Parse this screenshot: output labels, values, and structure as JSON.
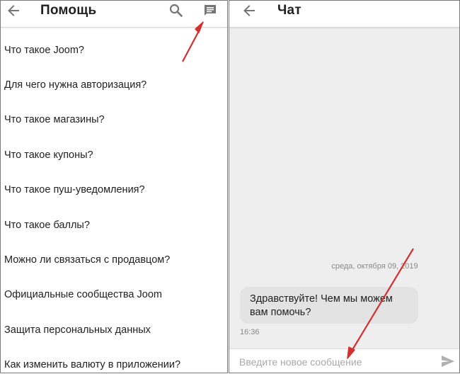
{
  "help_screen": {
    "title": "Помощь",
    "icons": {
      "back": "arrow-left-icon",
      "search": "search-icon",
      "chat": "chat-icon"
    },
    "faq_items": [
      "Что такое Joom?",
      "Для чего нужна авторизация?",
      "Что такое магазины?",
      "Что такое купоны?",
      "Что такое пуш-уведомления?",
      "Что такое баллы?",
      "Можно ли связаться с продавцом?",
      "Официальные сообщества Joom",
      "Защита персональных данных",
      "Как изменить валюту в приложении?"
    ]
  },
  "chat_screen": {
    "title": "Чат",
    "date_label": "среда, октября 09, 2019",
    "message": {
      "text_line1": "Здравствуйте! Чем мы можем",
      "text_line2": "вам помочь?",
      "time": "16:36"
    },
    "composer": {
      "placeholder": "Введите новое сообщение"
    }
  },
  "colors": {
    "annotation_arrow": "#d32f2f",
    "icon_gray": "#757575",
    "bubble_bg": "#e3e3e3",
    "chat_bg": "#eeeeee"
  }
}
